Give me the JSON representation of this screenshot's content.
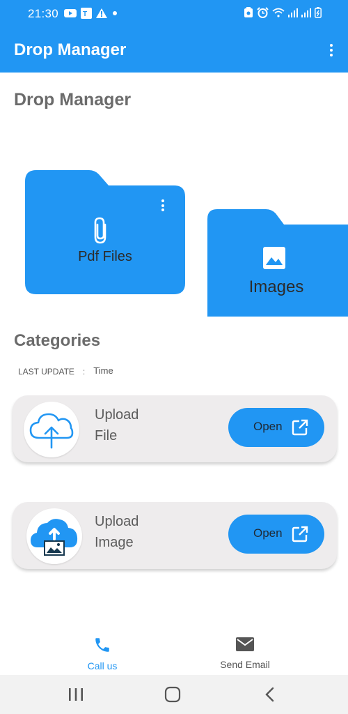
{
  "status_bar": {
    "time": "21:30",
    "left_icons": [
      "youtube-icon",
      "translate-icon",
      "alert-icon",
      "dot-icon"
    ],
    "right_icons": [
      "save-icon",
      "alarm-icon",
      "wifi-icon",
      "signal-icon",
      "signal-icon",
      "battery-icon"
    ]
  },
  "app_bar": {
    "title": "Drop Manager",
    "menu_icon": "more-vert-icon"
  },
  "header": {
    "title": "Drop Manager"
  },
  "folders": [
    {
      "label": "Pdf Files",
      "icon": "paperclip-icon",
      "menu_icon": "more-vert-icon"
    },
    {
      "label": "Images",
      "icon": "image-icon"
    }
  ],
  "categories": {
    "title": "Categories",
    "last_update_label": "LAST UPDATE",
    "separator": ":",
    "last_update_value": "Time",
    "cards": [
      {
        "title": "Upload File",
        "icon": "cloud-upload-icon",
        "button_label": "Open",
        "button_icon": "open-external-icon"
      },
      {
        "title": "Upload Image",
        "icon": "cloud-image-upload-icon",
        "button_label": "Open",
        "button_icon": "open-external-icon"
      }
    ]
  },
  "bottom_nav": [
    {
      "label": "Call us",
      "icon": "phone-icon",
      "active": true
    },
    {
      "label": "Send Email",
      "icon": "email-icon",
      "active": false
    }
  ],
  "system_nav": [
    "recents-icon",
    "home-icon",
    "back-icon"
  ],
  "colors": {
    "primary": "#2196f3",
    "card_bg": "#eeeced",
    "text": "#6b6b6b"
  }
}
